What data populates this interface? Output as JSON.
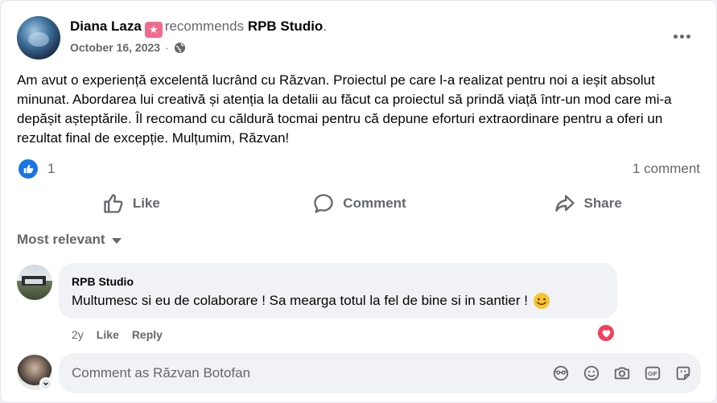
{
  "post": {
    "author": "Diana Laza",
    "verb": "recommends",
    "page": "RPB Studio",
    "punct": ".",
    "date": "October 16, 2023",
    "date_separator": "·",
    "body": "Am avut o experiență excelentă lucrând cu Răzvan. Proiectul pe care l-a realizat pentru noi a ieșit absolut minunat. Abordarea lui creativă și atenția la detalii au făcut ca proiectul să prindă viață într-un mod care mi-a depășit așteptările. Îl recomand cu căldură tocmai pentru că depune eforturi extraordinare pentru a oferi un rezultat final de excepție. Mulțumim, Răzvan!",
    "like_count": "1",
    "comment_count": "1 comment"
  },
  "actions": {
    "like": "Like",
    "comment": "Comment",
    "share": "Share"
  },
  "sort": {
    "label": "Most relevant"
  },
  "comments": [
    {
      "author": "RPB Studio",
      "text": "Multumesc si eu de colaborare ! Sa mearga totul la fel de bine si in santier !",
      "age": "2y",
      "like_label": "Like",
      "reply_label": "Reply"
    }
  ],
  "composer": {
    "placeholder": "Comment as Răzvan Botofan"
  },
  "colors": {
    "accent": "#1b74e4",
    "heart": "#f33e58",
    "badge": "#f26a8d",
    "muted_text": "#65676b"
  },
  "icons": {
    "privacy": "globe-icon",
    "more": "more-options-icon",
    "like": "thumbs-up-icon",
    "comment": "speech-bubble-icon",
    "share": "share-arrow-icon",
    "reaction": "heart-icon",
    "composer_tools": [
      "avatar-sticker-icon",
      "emoji-icon",
      "camera-icon",
      "gif-icon",
      "sticker-icon"
    ]
  }
}
